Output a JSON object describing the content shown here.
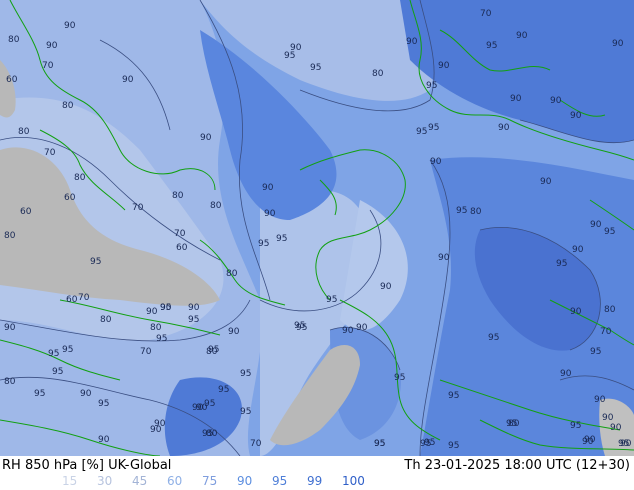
{
  "footer": {
    "left_title": "RH 850 hPa [%] UK-Global",
    "right_title": "Th 23-01-2025 18:00 UTC (12+30)"
  },
  "legend": [
    {
      "label": "15",
      "color": "#c9d3e6"
    },
    {
      "label": "30",
      "color": "#b6c3de"
    },
    {
      "label": "45",
      "color": "#a3b4d6"
    },
    {
      "label": "60",
      "color": "#8fb0e6"
    },
    {
      "label": "75",
      "color": "#7f9ede"
    },
    {
      "label": "90",
      "color": "#5d8fe0"
    },
    {
      "label": "95",
      "color": "#4f7fd8"
    },
    {
      "label": "99",
      "color": "#3f6fd0"
    },
    {
      "label": "100",
      "color": "#2f5fc8"
    }
  ],
  "contour_labels": [
    "90",
    "80",
    "90",
    "70",
    "60",
    "80",
    "90",
    "80",
    "70",
    "60",
    "80",
    "60",
    "70",
    "80",
    "70",
    "60",
    "80",
    "90",
    "80",
    "80",
    "70",
    "60",
    "80",
    "70",
    "90",
    "95",
    "80",
    "90",
    "95",
    "80",
    "90",
    "95",
    "90",
    "95",
    "80",
    "90",
    "90",
    "90",
    "95",
    "95",
    "80",
    "95",
    "95",
    "95",
    "90",
    "95",
    "90",
    "95",
    "90",
    "95",
    "95",
    "90",
    "95",
    "90",
    "95",
    "80",
    "90",
    "70",
    "95",
    "90",
    "90",
    "90",
    "95",
    "90",
    "90",
    "90",
    "90",
    "95",
    "95",
    "90",
    "90",
    "95",
    "80",
    "90",
    "95",
    "90",
    "90",
    "95",
    "90",
    "95",
    "90",
    "90",
    "95",
    "95",
    "90",
    "80",
    "70",
    "95",
    "90",
    "95",
    "95",
    "95",
    "95",
    "90",
    "90",
    "90",
    "95",
    "95",
    "95",
    "90",
    "80",
    "70",
    "95",
    "90",
    "90",
    "95",
    "95",
    "95",
    "95",
    "90",
    "95",
    "95",
    "95",
    "90"
  ],
  "colors": {
    "land_gray": "#b8b8b8",
    "coast": "#12a012",
    "contour": "#3a4e82"
  }
}
